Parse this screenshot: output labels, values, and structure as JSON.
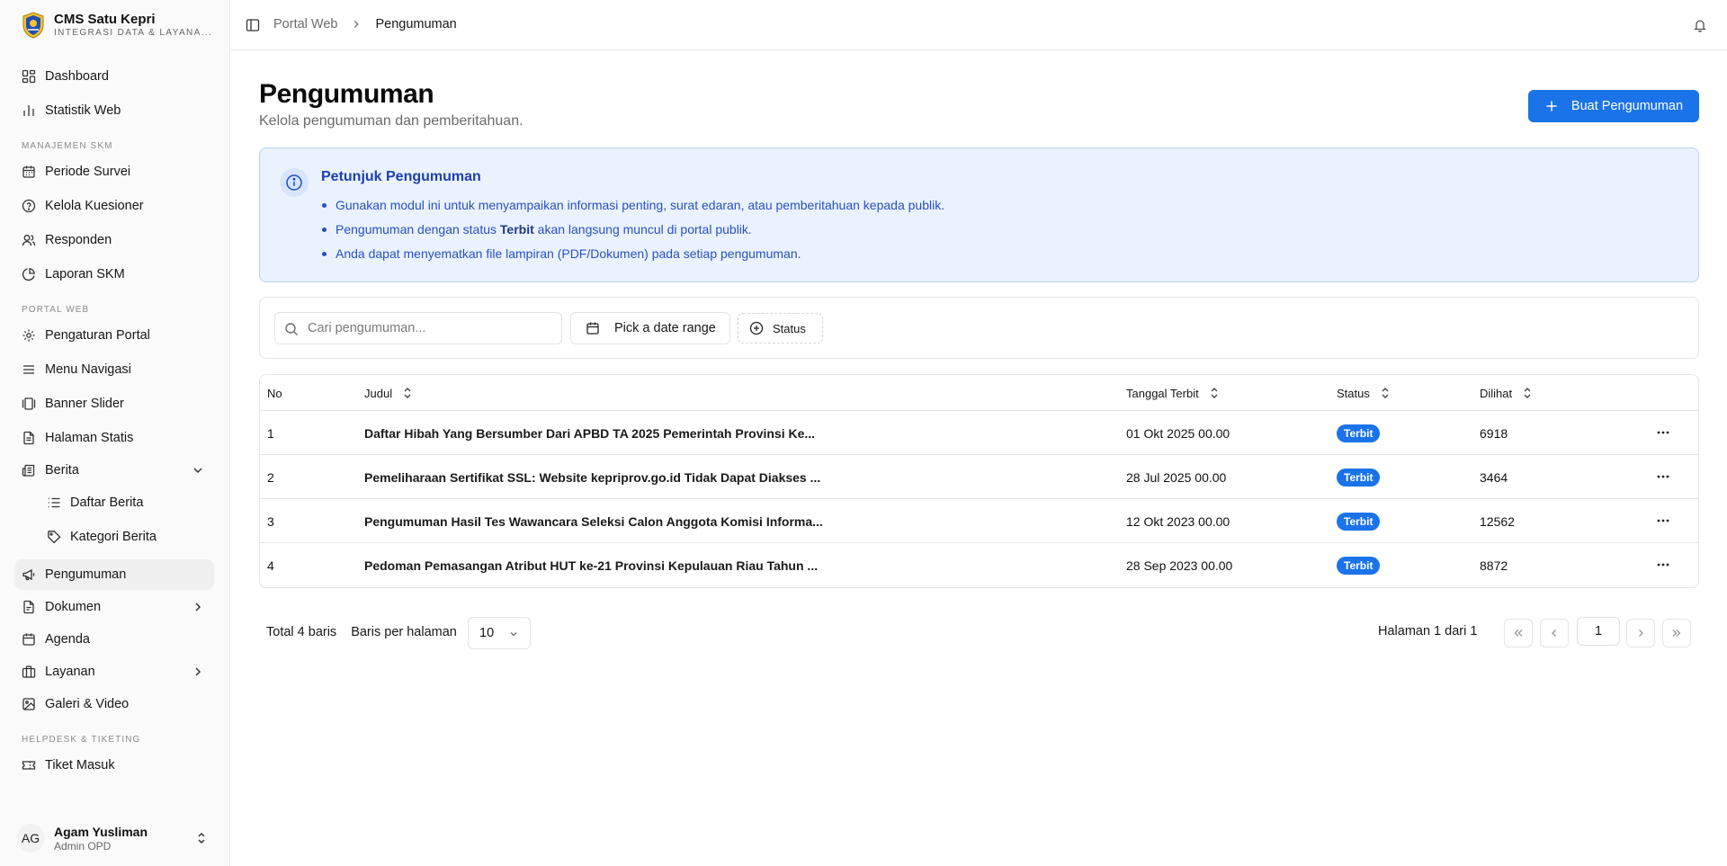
{
  "brand": {
    "title": "CMS Satu Kepri",
    "subtitle": "INTEGRASI DATA & LAYANA..."
  },
  "sidebar": {
    "items": [
      {
        "label": "Dashboard",
        "icon": "grid-icon"
      },
      {
        "label": "Statistik Web",
        "icon": "bar-chart-icon"
      }
    ],
    "group_skm": "MANAJEMEN SKM",
    "skm_items": [
      {
        "label": "Periode Survei",
        "icon": "calendar-icon"
      },
      {
        "label": "Kelola Kuesioner",
        "icon": "help-circle-icon"
      },
      {
        "label": "Responden",
        "icon": "users-icon"
      },
      {
        "label": "Laporan SKM",
        "icon": "pie-chart-icon"
      }
    ],
    "group_portal": "PORTAL WEB",
    "portal_items": [
      {
        "label": "Pengaturan Portal",
        "icon": "gear-icon"
      },
      {
        "label": "Menu Navigasi",
        "icon": "menu-icon"
      },
      {
        "label": "Banner Slider",
        "icon": "slides-icon"
      },
      {
        "label": "Halaman Statis",
        "icon": "file-icon"
      },
      {
        "label": "Berita",
        "icon": "newspaper-icon",
        "expanded": true
      },
      {
        "label": "Daftar Berita",
        "icon": "list-icon"
      },
      {
        "label": "Kategori Berita",
        "icon": "tag-icon"
      },
      {
        "label": "Pengumuman",
        "icon": "megaphone-icon",
        "active": true
      },
      {
        "label": "Dokumen",
        "icon": "document-icon"
      },
      {
        "label": "Agenda",
        "icon": "calendar-icon"
      },
      {
        "label": "Layanan",
        "icon": "briefcase-icon"
      },
      {
        "label": "Galeri & Video",
        "icon": "image-icon"
      }
    ],
    "group_helpdesk": "HELPDESK & TIKETING",
    "helpdesk_items": [
      {
        "label": "Tiket Masuk",
        "icon": "ticket-icon"
      }
    ]
  },
  "user": {
    "initials": "AG",
    "name": "Agam Yusliman",
    "role": "Admin OPD"
  },
  "breadcrumb": {
    "parent": "Portal Web",
    "current": "Pengumuman"
  },
  "page": {
    "title": "Pengumuman",
    "description": "Kelola pengumuman dan pemberitahuan.",
    "create_button": "Buat Pengumuman"
  },
  "info": {
    "title": "Petunjuk Pengumuman",
    "line1": "Gunakan modul ini untuk menyampaikan informasi penting, surat edaran, atau pemberitahuan kepada publik.",
    "line2_pre": "Pengumuman dengan status ",
    "line2_bold": "Terbit",
    "line2_post": " akan langsung muncul di portal publik.",
    "line3": "Anda dapat menyematkan file lampiran (PDF/Dokumen) pada setiap pengumuman."
  },
  "filters": {
    "search_placeholder": "Cari pengumuman...",
    "date_label": "Pick a date range",
    "status_label": "Status"
  },
  "table": {
    "headers": {
      "no": "No",
      "judul": "Judul",
      "tanggal": "Tanggal Terbit",
      "status": "Status",
      "dilihat": "Dilihat"
    },
    "rows": [
      {
        "no": "1",
        "judul": "Daftar Hibah Yang Bersumber Dari APBD TA 2025 Pemerintah Provinsi Ke...",
        "tanggal": "01 Okt 2025 00.00",
        "status": "Terbit",
        "dilihat": "6918"
      },
      {
        "no": "2",
        "judul": "Pemeliharaan Sertifikat SSL: Website kepriprov.go.id Tidak Dapat Diakses ...",
        "tanggal": "28 Jul 2025 00.00",
        "status": "Terbit",
        "dilihat": "3464"
      },
      {
        "no": "3",
        "judul": "Pengumuman Hasil Tes Wawancara Seleksi Calon Anggota Komisi Informa...",
        "tanggal": "12 Okt 2023 00.00",
        "status": "Terbit",
        "dilihat": "12562"
      },
      {
        "no": "4",
        "judul": "Pedoman Pemasangan Atribut HUT ke-21 Provinsi Kepulauan Riau Tahun ...",
        "tanggal": "28 Sep 2023 00.00",
        "status": "Terbit",
        "dilihat": "8872"
      }
    ]
  },
  "pagination": {
    "total": "Total 4 baris",
    "rows_per_page_label": "Baris per halaman",
    "rows_per_page_value": "10",
    "page_label": "Halaman 1 dari 1",
    "current_page": "1"
  },
  "colors": {
    "accent": "#1a73e8",
    "info_bg": "#eaf2fe",
    "info_text": "#2551c5"
  }
}
